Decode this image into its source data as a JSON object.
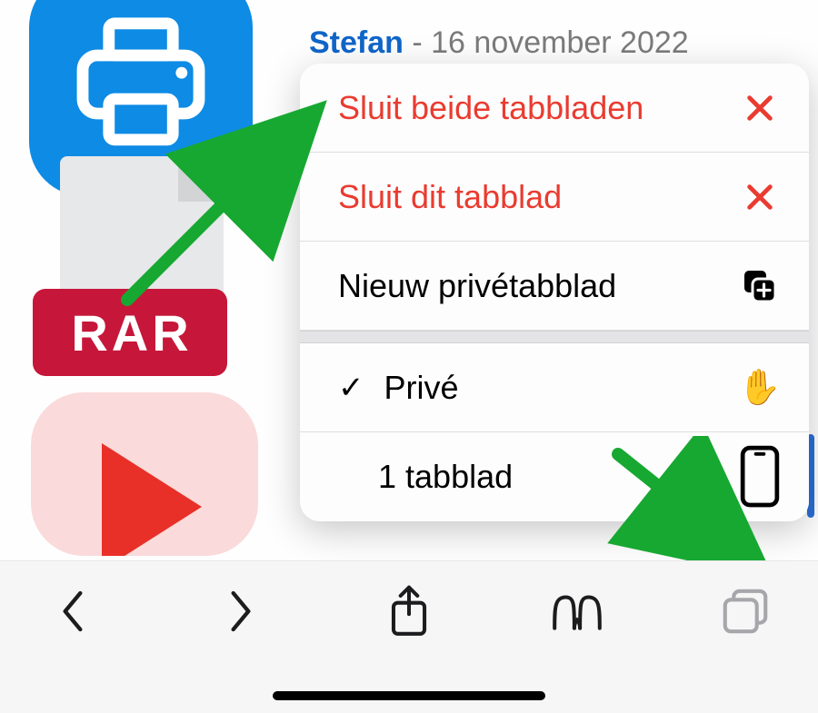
{
  "author": {
    "name": "Stefan",
    "separator": " - ",
    "date": "16 november 2022"
  },
  "file_badge": "RAR",
  "menu": {
    "close_both": "Sluit beide tabbladen",
    "close_this": "Sluit dit tabblad",
    "new_private": "Nieuw privétabblad",
    "private_group": "Privé",
    "tabs_group": "1 tabblad"
  }
}
